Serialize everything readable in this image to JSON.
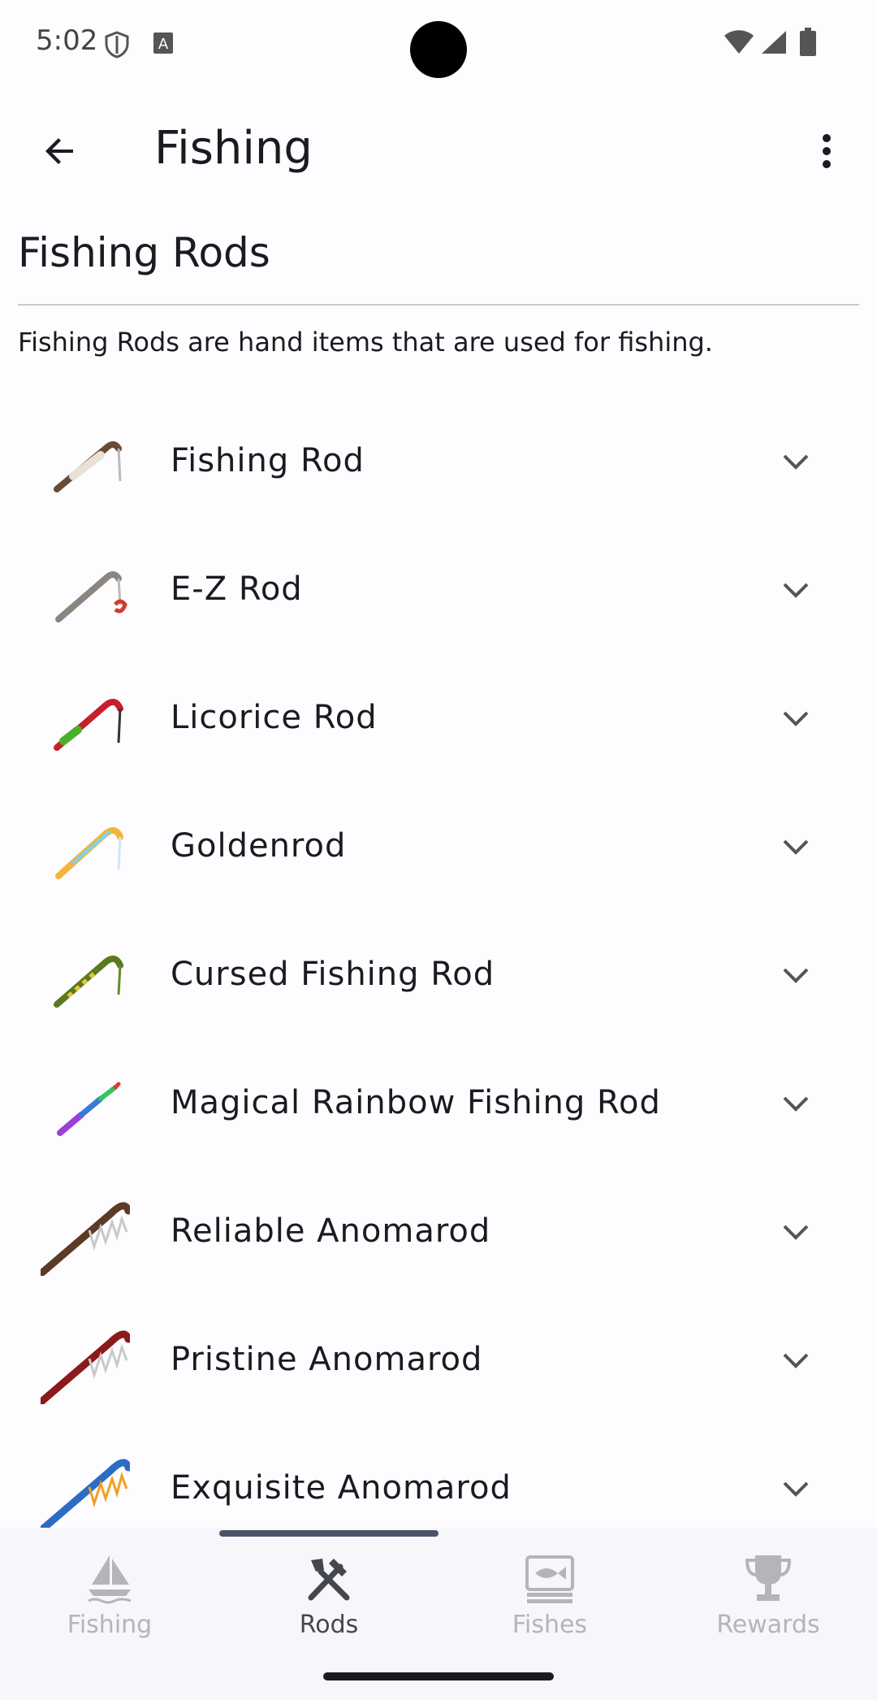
{
  "status": {
    "time": "5:02"
  },
  "app_bar": {
    "title": "Fishing"
  },
  "section": {
    "title": "Fishing Rods",
    "description": "Fishing Rods are hand items that are used for fishing."
  },
  "rods": [
    {
      "label": "Fishing Rod",
      "icon": "fishing-rod-icon",
      "colors": [
        "#6b4a34",
        "#e9e1d6"
      ]
    },
    {
      "label": "E-Z Rod",
      "icon": "ez-rod-icon",
      "colors": [
        "#8a857f",
        "#d33a2c"
      ]
    },
    {
      "label": "Licorice Rod",
      "icon": "licorice-rod-icon",
      "colors": [
        "#c8202a",
        "#4caf2a"
      ]
    },
    {
      "label": "Goldenrod",
      "icon": "goldenrod-icon",
      "colors": [
        "#f2b43a",
        "#7fd2f0"
      ]
    },
    {
      "label": "Cursed Fishing Rod",
      "icon": "cursed-rod-icon",
      "colors": [
        "#5a7a1e",
        "#e9c534"
      ]
    },
    {
      "label": "Magical Rainbow Fishing Rod",
      "icon": "rainbow-rod-icon",
      "colors": [
        "#9b3fd6",
        "#36c45a"
      ]
    },
    {
      "label": "Reliable Anomarod",
      "icon": "reliable-anomarod-icon",
      "colors": [
        "#5b3a26",
        "#c9c9c9"
      ]
    },
    {
      "label": "Pristine Anomarod",
      "icon": "pristine-anomarod-icon",
      "colors": [
        "#8b1a1a",
        "#c9c9c9"
      ]
    },
    {
      "label": "Exquisite Anomarod",
      "icon": "exquisite-anomarod-icon",
      "colors": [
        "#2d6cc4",
        "#f0a020"
      ]
    }
  ],
  "nav": {
    "items": [
      {
        "label": "Fishing",
        "icon": "sailboat-icon",
        "active": false
      },
      {
        "label": "Rods",
        "icon": "crossed-tools-icon",
        "active": true
      },
      {
        "label": "Fishes",
        "icon": "fish-card-icon",
        "active": false
      },
      {
        "label": "Rewards",
        "icon": "trophy-icon",
        "active": false
      }
    ]
  }
}
